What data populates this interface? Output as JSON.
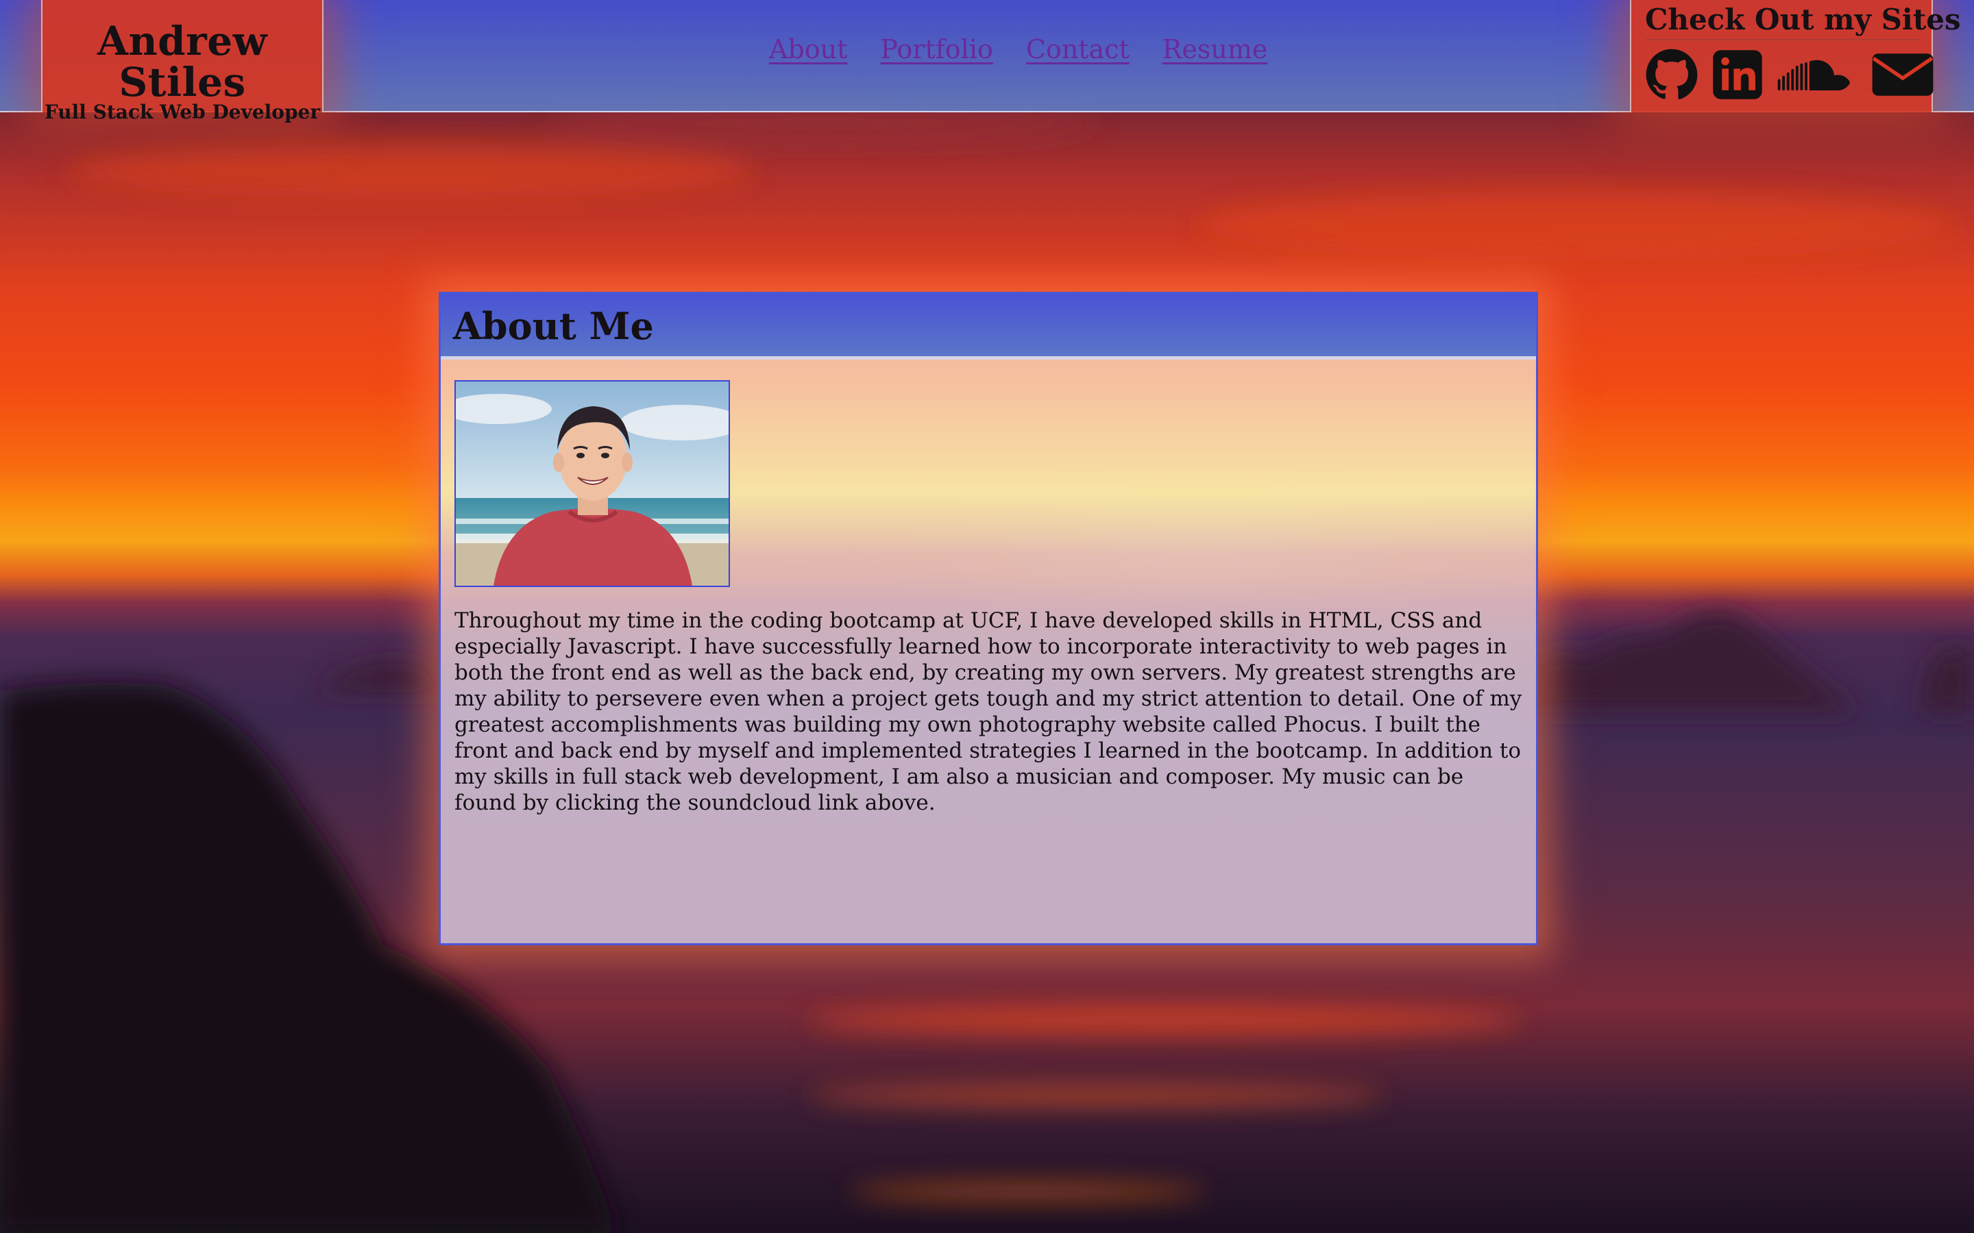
{
  "header": {
    "brand_name": "Andrew Stiles",
    "brand_tagline": "Full Stack Web Developer",
    "nav": [
      {
        "label": "About",
        "icon": null
      },
      {
        "label": "Portfolio",
        "icon": null
      },
      {
        "label": "Contact",
        "icon": null
      },
      {
        "label": "Resume",
        "icon": null
      }
    ],
    "sites_title": "Check Out my Sites",
    "sites": [
      {
        "icon": "github-icon"
      },
      {
        "icon": "linkedin-icon"
      },
      {
        "icon": "soundcloud-icon"
      },
      {
        "icon": "envelope-icon"
      }
    ]
  },
  "about": {
    "title": "About Me",
    "photo": "profile-photo",
    "bio": "Throughout my time in the coding bootcamp at UCF, I have developed skills in HTML, CSS and especially Javascript. I have successfully learned how to incorporate interactivity to web pages in both the front end as well as the back end, by creating my own servers. My greatest strengths are my ability to persevere even when a project gets tough and my strict attention to detail. One of my greatest accomplishments was building my own photography website called Phocus. I built the front and back end by myself and implemented strategies I learned in the bootcamp. In addition to my skills in full stack web development, I am also a musician and composer. My music can be found by clicking the soundcloud link above."
  },
  "colors": {
    "header_blue": "#4a52d6",
    "brand_red": "#d63622",
    "nav_link": "#6a2a9a",
    "text": "#141014"
  }
}
